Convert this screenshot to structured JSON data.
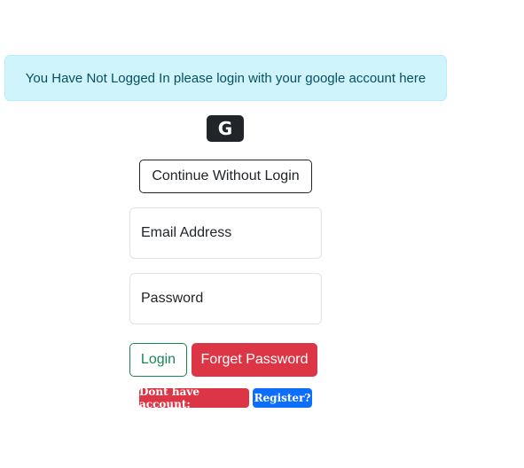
{
  "alert": {
    "text": "You Have Not Logged In please login with your google account here"
  },
  "google_button": {
    "glyph": "G",
    "icon": "google-icon"
  },
  "continue_button": {
    "label": "Continue Without Login"
  },
  "form": {
    "email_placeholder": "Email Address",
    "password_placeholder": "Password",
    "login_label": "Login",
    "forget_label": "Forget Password"
  },
  "footer": {
    "no_account_text": "Dont have account:",
    "register_label": "Register?"
  },
  "colors": {
    "alert_bg": "#cff4fc",
    "alert_text": "#055160",
    "dark": "#212529",
    "success": "#198754",
    "danger": "#dc3545",
    "primary": "#0d6efd"
  }
}
